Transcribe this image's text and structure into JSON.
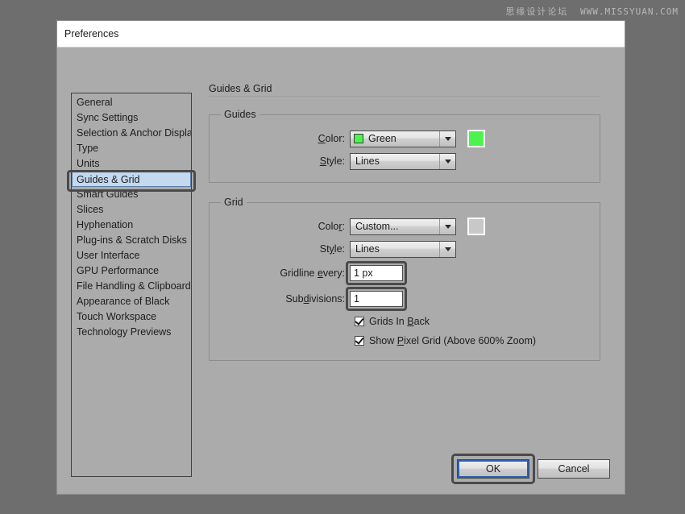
{
  "watermark": {
    "chinese": "思缘设计论坛",
    "url": "WWW.MISSYUAN.COM"
  },
  "window": {
    "title": "Preferences"
  },
  "sidebar": {
    "items": [
      {
        "label": "General",
        "selected": false
      },
      {
        "label": "Sync Settings",
        "selected": false
      },
      {
        "label": "Selection & Anchor Display",
        "selected": false
      },
      {
        "label": "Type",
        "selected": false
      },
      {
        "label": "Units",
        "selected": false
      },
      {
        "label": "Guides & Grid",
        "selected": true
      },
      {
        "label": "Smart Guides",
        "selected": false
      },
      {
        "label": "Slices",
        "selected": false
      },
      {
        "label": "Hyphenation",
        "selected": false
      },
      {
        "label": "Plug-ins & Scratch Disks",
        "selected": false
      },
      {
        "label": "User Interface",
        "selected": false
      },
      {
        "label": "GPU Performance",
        "selected": false
      },
      {
        "label": "File Handling & Clipboard",
        "selected": false
      },
      {
        "label": "Appearance of Black",
        "selected": false
      },
      {
        "label": "Touch Workspace",
        "selected": false
      },
      {
        "label": "Technology Previews",
        "selected": false
      }
    ]
  },
  "pane": {
    "heading": "Guides & Grid",
    "guides": {
      "legend": "Guides",
      "color_label_pre": "",
      "color_label_mn": "C",
      "color_label_post": "olor:",
      "color_value": "Green",
      "color_hex": "#4df34d",
      "preview_hex": "#4df34d",
      "style_label_pre": "",
      "style_label_mn": "S",
      "style_label_post": "tyle:",
      "style_value": "Lines"
    },
    "grid": {
      "legend": "Grid",
      "color_label_pre": "Colo",
      "color_label_mn": "r",
      "color_label_post": ":",
      "color_value": "Custom...",
      "preview_hex": "#c8c8c8",
      "style_label_pre": "St",
      "style_label_mn": "y",
      "style_label_post": "le:",
      "style_value": "Lines",
      "gridline_label_pre": "Gridline ",
      "gridline_label_mn": "e",
      "gridline_label_post": "very:",
      "gridline_value": "1 px",
      "subdiv_label_pre": "Sub",
      "subdiv_label_mn": "d",
      "subdiv_label_post": "ivisions:",
      "subdiv_value": "1",
      "check_back_pre": "Grids In ",
      "check_back_mn": "B",
      "check_back_post": "ack",
      "check_back_checked": true,
      "check_pixel_pre": "Show ",
      "check_pixel_mn": "P",
      "check_pixel_post": "ixel Grid (Above 600% Zoom)",
      "check_pixel_checked": true
    }
  },
  "footer": {
    "ok_label": "OK",
    "cancel_label": "Cancel"
  }
}
